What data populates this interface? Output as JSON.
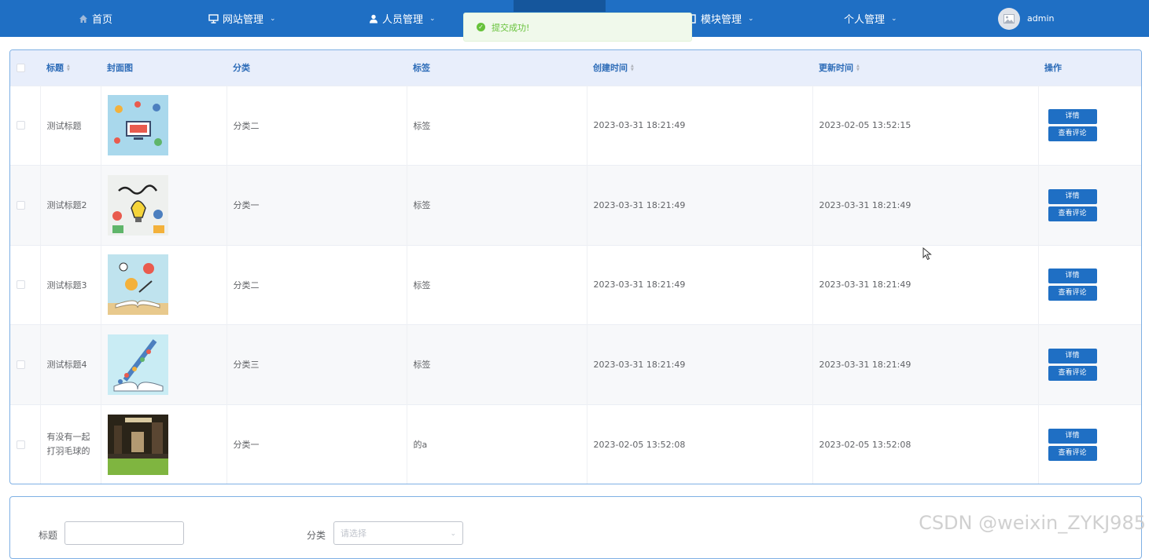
{
  "nav": {
    "home": "首页",
    "site_mgmt": "网站管理",
    "people_mgmt": "人员管理",
    "module_mgmt": "模块管理",
    "personal_mgmt": "个人管理",
    "username": "admin"
  },
  "toast": {
    "message": "提交成功!"
  },
  "table": {
    "headers": [
      "标题",
      "封面图",
      "分类",
      "标签",
      "创建时间",
      "更新时间",
      "操作"
    ],
    "rows": [
      {
        "title": "测试标题",
        "category": "分类二",
        "tag": "标签",
        "created": "2023-03-31 18:21:49",
        "updated": "2023-02-05 13:52:15"
      },
      {
        "title": "测试标题2",
        "category": "分类一",
        "tag": "标签",
        "created": "2023-03-31 18:21:49",
        "updated": "2023-03-31 18:21:49"
      },
      {
        "title": "测试标题3",
        "category": "分类二",
        "tag": "标签",
        "created": "2023-03-31 18:21:49",
        "updated": "2023-03-31 18:21:49"
      },
      {
        "title": "测试标题4",
        "category": "分类三",
        "tag": "标签",
        "created": "2023-03-31 18:21:49",
        "updated": "2023-03-31 18:21:49"
      },
      {
        "title": "有没有一起打羽毛球的",
        "category": "分类一",
        "tag": "的a",
        "created": "2023-02-05 13:52:08",
        "updated": "2023-02-05 13:52:08"
      }
    ],
    "detail_label": "详情",
    "comments_label": "查看评论"
  },
  "search": {
    "title_label": "标题",
    "category_label": "分类",
    "category_placeholder": "请选择"
  },
  "watermark": "CSDN @weixin_ZYKJ985",
  "colors": {
    "primary": "#1f6fc4",
    "success": "#67c23a"
  }
}
